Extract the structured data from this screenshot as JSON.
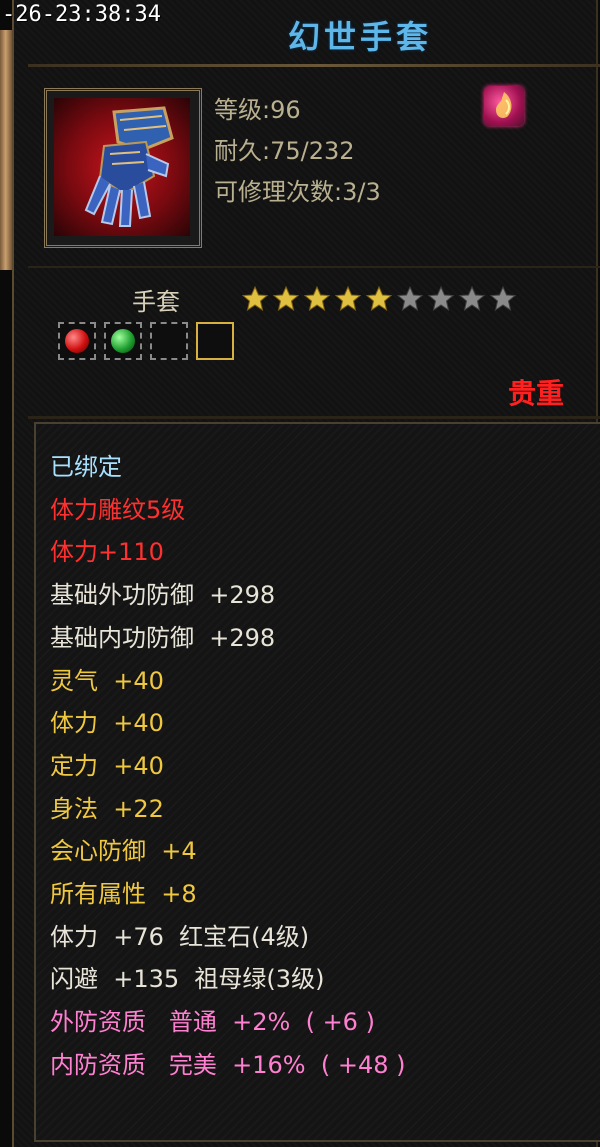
{
  "timestamp": "-26-23:38:34",
  "item": {
    "name": "幻世手套",
    "level_text": "等级:96",
    "durability_text": "耐久:75/232",
    "repair_text": "可修理次数:3/3",
    "type_label": "手套",
    "stars_total": 9,
    "stars_filled": 5,
    "rarity_label": "贵重",
    "sockets": [
      {
        "gem": "ruby"
      },
      {
        "gem": "emerald"
      },
      {
        "gem": "empty"
      },
      {
        "gem": "empty-gold"
      }
    ]
  },
  "attributes": [
    {
      "text": "已绑定",
      "color": "bound"
    },
    {
      "text": "体力雕纹5级",
      "color": "red"
    },
    {
      "text": "体力+110",
      "color": "red"
    },
    {
      "text": "基础外功防御  +298",
      "color": "white"
    },
    {
      "text": "基础内功防御  +298",
      "color": "white"
    },
    {
      "text": "灵气  +40",
      "color": "gold"
    },
    {
      "text": "体力  +40",
      "color": "gold"
    },
    {
      "text": "定力  +40",
      "color": "gold"
    },
    {
      "text": "身法  +22",
      "color": "gold"
    },
    {
      "text": "会心防御  +4",
      "color": "gold"
    },
    {
      "text": "所有属性  +8",
      "color": "gold"
    },
    {
      "text": "体力  +76  红宝石(4级)",
      "color": "white"
    },
    {
      "text": "闪避  +135  祖母绿(3级)",
      "color": "white"
    },
    {
      "text": "外防资质   普通  +2%  ( +6 )",
      "color": "pink"
    },
    {
      "text": "内防资质   完美  +16%  ( +48 )",
      "color": "pink"
    }
  ],
  "colors": {
    "title": "#5fb6e8",
    "rarity": "#ff2020",
    "star_filled": "#e0c040",
    "star_empty": "#8a8a8a"
  },
  "icons": {
    "item": "gauntlet-icon",
    "badge": "fire-badge-icon"
  }
}
